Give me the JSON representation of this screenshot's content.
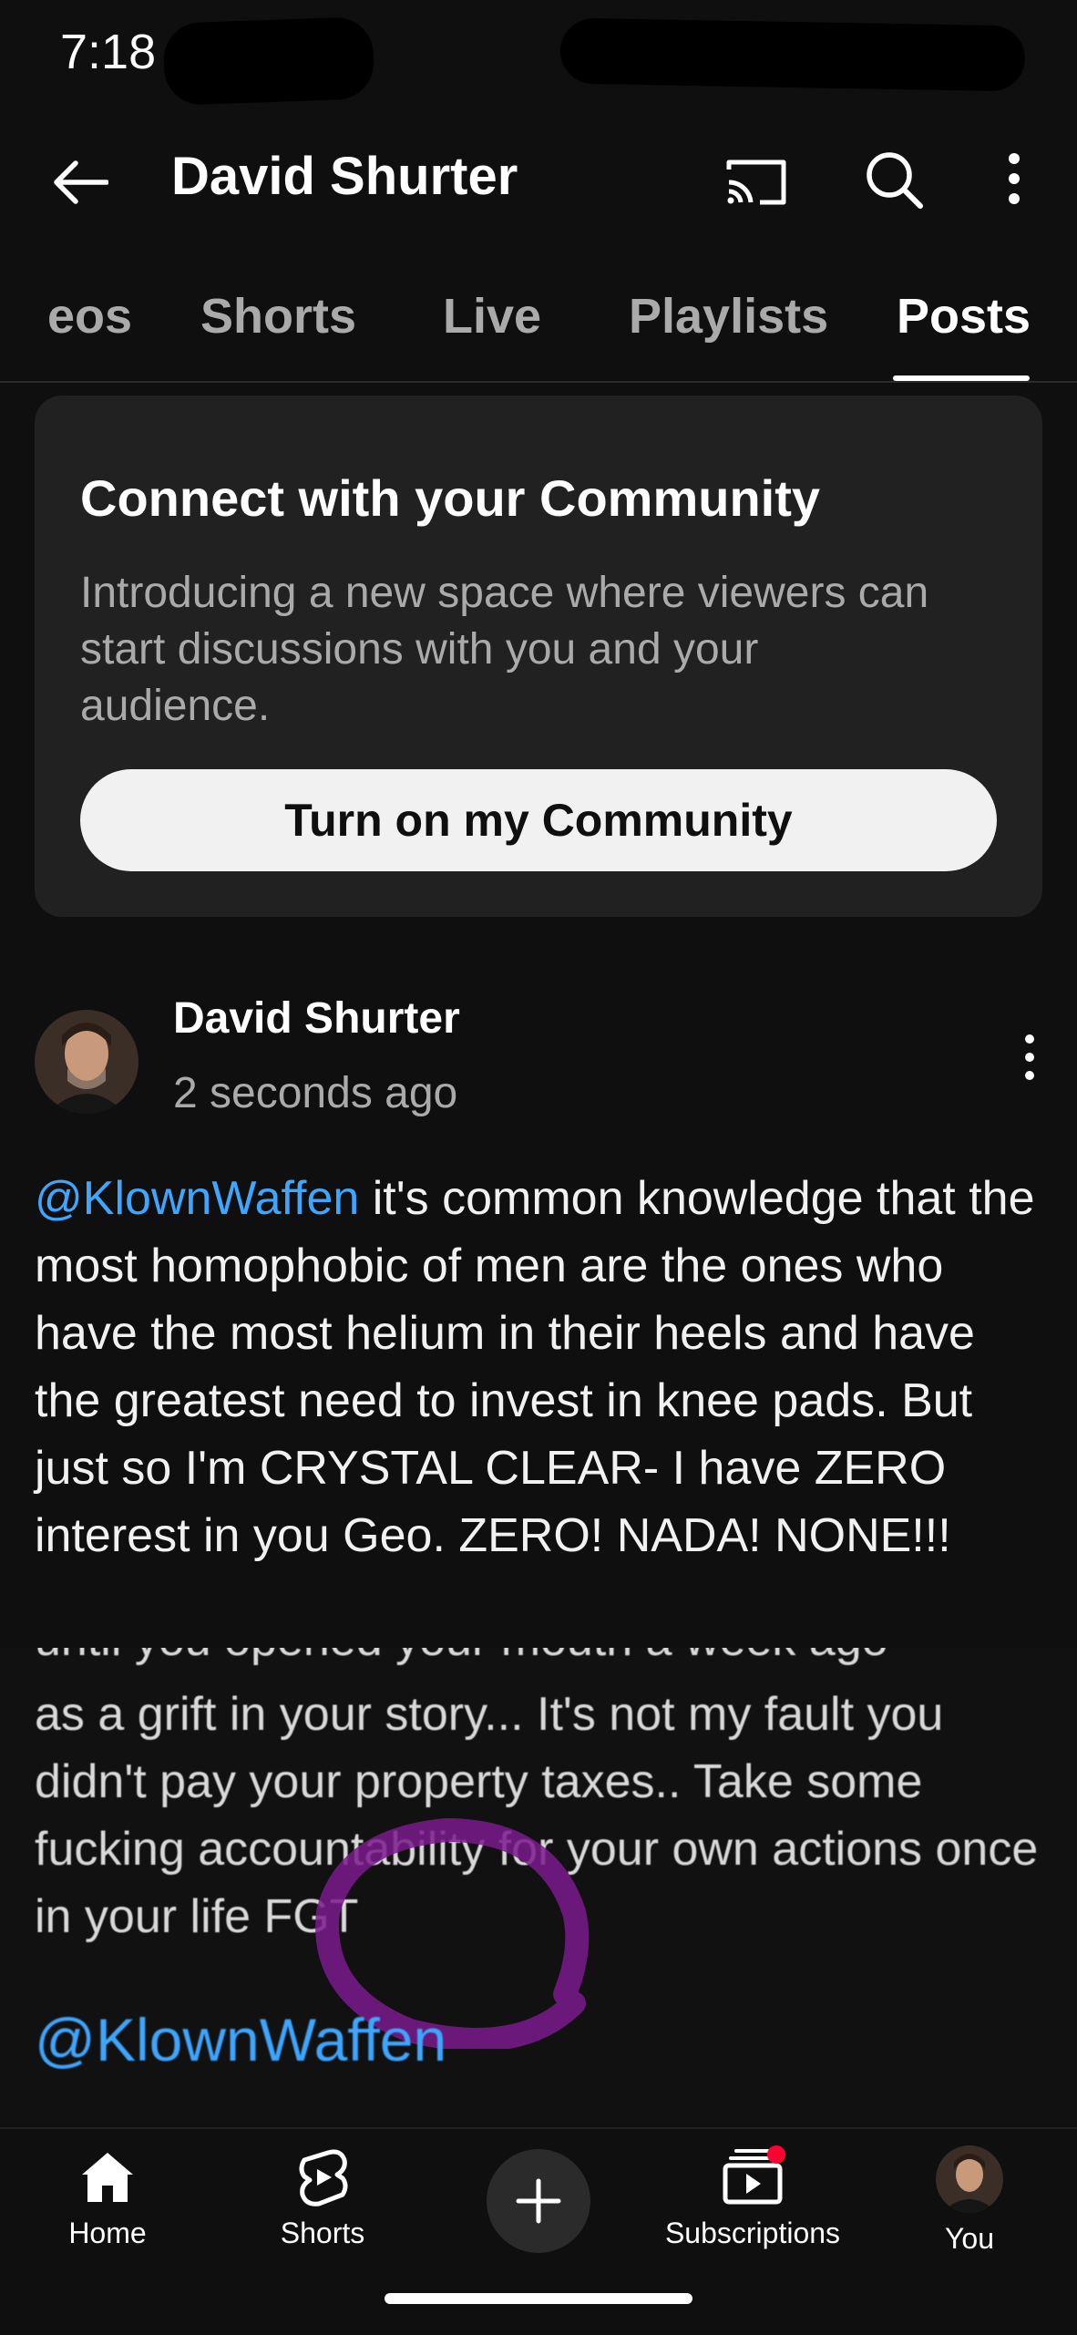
{
  "status_bar": {
    "time": "7:18"
  },
  "header": {
    "title": "David Shurter",
    "icons": [
      "back-arrow-icon",
      "cast-icon",
      "search-icon",
      "more-vert-icon"
    ]
  },
  "tabs": [
    {
      "label": "eos",
      "active": false
    },
    {
      "label": "Shorts",
      "active": false
    },
    {
      "label": "Live",
      "active": false
    },
    {
      "label": "Playlists",
      "active": false
    },
    {
      "label": "Posts",
      "active": true
    }
  ],
  "community_card": {
    "title": "Connect with your Community",
    "description": "Introducing a new space where viewers can start discussions with you and your audience.",
    "button_label": "Turn on my Community"
  },
  "post": {
    "author": "David Shurter",
    "time": "2 seconds ago",
    "mention": "@KlownWaffen",
    "text": " it's common knowledge that the most homophobic of men are the ones who have the most helium in their heels and have the greatest need to invest in knee pads. But just so I'm CRYSTAL CLEAR- I have ZERO interest in you Geo. ZERO! NADA! NONE!!!",
    "image": {
      "cut_line": "until you opened  your mouth a week ago",
      "text": "as a grift in your story... It's not my fault you didn't pay your property taxes.. Take some fucking accountability for your own actions once in your life FGT",
      "mention": "@KlownWaffen"
    }
  },
  "bottom_nav": [
    {
      "label": "Home",
      "icon": "home-icon"
    },
    {
      "label": "Shorts",
      "icon": "shorts-icon"
    },
    {
      "label": "",
      "icon": "create-plus-icon"
    },
    {
      "label": "Subscriptions",
      "icon": "subscriptions-icon"
    },
    {
      "label": "You",
      "icon": "avatar"
    }
  ],
  "colors": {
    "background": "#0f0f0f",
    "card": "#212121",
    "mention": "#3ea6ff",
    "secondary_text": "#aaaaaa",
    "notification_dot": "#ff0033",
    "annotation_circle": "#7a1a8c"
  }
}
